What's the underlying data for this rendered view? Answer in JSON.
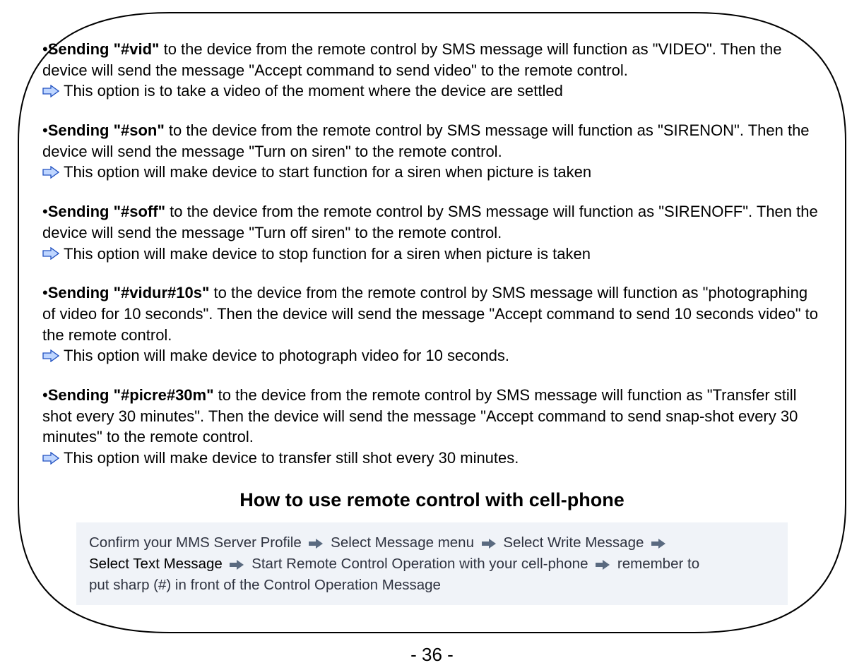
{
  "sections": [
    {
      "lead_bold": "Sending \"#vid\"",
      "lead_rest": " to the device from the remote control by SMS message will function as \"VIDEO\". Then the device will send the message \"Accept command to send video\" to the remote control.",
      "note": "This option is to take a video of the moment where the device are settled"
    },
    {
      "lead_bold": "Sending \"#son\"",
      "lead_rest": " to the device from the remote control by SMS message will function as \"SIRENON\". Then the device will send the message \"Turn on siren\" to the remote control.",
      "note": "This option will make device to start function for a siren when picture is taken"
    },
    {
      "lead_bold": "Sending \"#soff\"",
      "lead_rest": " to the device from the remote control by SMS message will function as \"SIRENOFF\". Then the device will send the message \"Turn off siren\" to the remote control.",
      "note": "This option will make device to stop function for a siren when picture is taken"
    },
    {
      "lead_bold": "Sending \"#vidur#10s\"",
      "lead_rest": " to the device from the remote control by SMS message will function as \"photographing of video for 10 seconds\". Then the device will send the message \"Accept command to send 10 seconds video\" to the remote control.",
      "note": "This option will make device to photograph video for 10 seconds."
    },
    {
      "lead_bold": "Sending \"#picre#30m\"",
      "lead_rest": " to the device from the remote control by SMS message will function as \"Transfer still shot every 30 minutes\".  Then the device will send the message \"Accept command to send snap-shot every 30 minutes\" to the remote control.",
      "note": "This option will make device to transfer still shot every 30 minutes."
    }
  ],
  "heading": "How to use remote control with cell-phone",
  "howto": {
    "step1": "Confirm your MMS Server Profile",
    "step2": "Select Message menu",
    "step3": "Select Write Message",
    "step4": "Select Text Message",
    "step5": "Start Remote Control Operation with your cell-phone",
    "step6a": "remember to",
    "step6b": "put sharp (#) in front of the Control Operation Message"
  },
  "page_number": "- 36 -"
}
